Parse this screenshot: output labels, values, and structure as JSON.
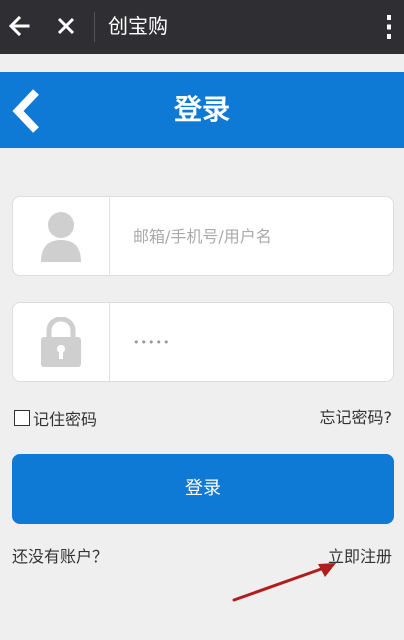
{
  "topbar": {
    "title": "创宝购"
  },
  "header": {
    "title": "登录"
  },
  "login_form": {
    "username_placeholder": "邮箱/手机号/用户名",
    "password_value": "•••••",
    "remember_label": "记住密码",
    "forgot_label": "忘记密码?",
    "login_button": "登录",
    "no_account_text": "还没有账户？",
    "register_link": "立即注册"
  },
  "colors": {
    "topbar_bg": "#2f2f33",
    "primary_blue": "#0f79d6",
    "page_bg": "#efefef",
    "annotation_arrow": "#b11c1c"
  },
  "icons": {
    "topbar_back": "arrow-left-icon",
    "topbar_close": "close-icon",
    "topbar_more": "more-vertical-icon",
    "header_back": "chevron-left-icon",
    "username": "user-avatar-icon",
    "password": "lock-icon"
  }
}
